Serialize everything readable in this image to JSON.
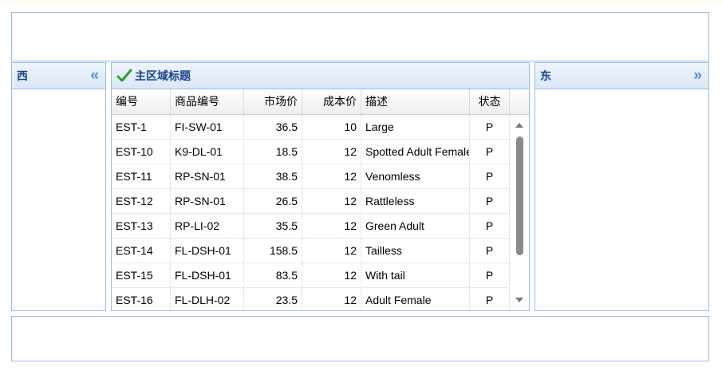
{
  "west": {
    "title": "西",
    "collapse_icon": "double-chevron-left-icon"
  },
  "east": {
    "title": "东",
    "collapse_icon": "double-chevron-right-icon"
  },
  "center": {
    "title": "主区域标题",
    "title_icon": "checkmark-icon",
    "columns": [
      "编号",
      "商品编号",
      "市场价",
      "成本价",
      "描述",
      "状态"
    ],
    "rows": [
      [
        "EST-1",
        "FI-SW-01",
        "36.5",
        "10",
        "Large",
        "P"
      ],
      [
        "EST-10",
        "K9-DL-01",
        "18.5",
        "12",
        "Spotted Adult Female",
        "P"
      ],
      [
        "EST-11",
        "RP-SN-01",
        "38.5",
        "12",
        "Venomless",
        "P"
      ],
      [
        "EST-12",
        "RP-SN-01",
        "26.5",
        "12",
        "Rattleless",
        "P"
      ],
      [
        "EST-13",
        "RP-LI-02",
        "35.5",
        "12",
        "Green Adult",
        "P"
      ],
      [
        "EST-14",
        "FL-DSH-01",
        "158.5",
        "12",
        "Tailless",
        "P"
      ],
      [
        "EST-15",
        "FL-DSH-01",
        "83.5",
        "12",
        "With tail",
        "P"
      ],
      [
        "EST-16",
        "FL-DLH-02",
        "23.5",
        "12",
        "Adult Female",
        "P"
      ]
    ]
  },
  "colors": {
    "border": "#99bbe8",
    "header_text": "#15428b",
    "accent": "#4a8fd8",
    "check": "#2aa02a"
  }
}
